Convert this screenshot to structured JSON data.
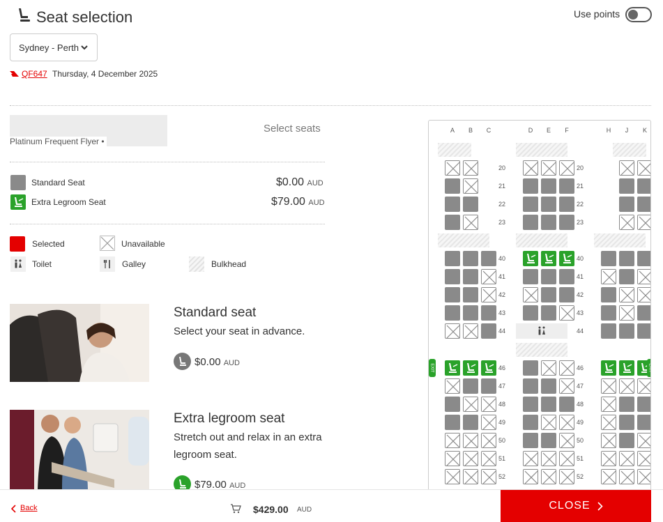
{
  "header": {
    "title": "Seat selection",
    "use_points_label": "Use points",
    "use_points_on": false
  },
  "route_select": {
    "value": "Sydney - Perth"
  },
  "flight": {
    "number": "QF647",
    "date": "Thursday, 4 December 2025"
  },
  "passenger": {
    "tier": "Platinum Frequent Flyer •",
    "select_seats_label": "Select seats"
  },
  "seat_types": [
    {
      "label": "Standard Seat",
      "price": "$0.00",
      "currency": "AUD"
    },
    {
      "label": "Extra Legroom Seat",
      "price": "$79.00",
      "currency": "AUD"
    }
  ],
  "legend": {
    "selected": "Selected",
    "unavailable": "Unavailable",
    "toilet": "Toilet",
    "galley": "Galley",
    "bulkhead": "Bulkhead"
  },
  "promos": [
    {
      "title": "Standard seat",
      "desc": "Select your seat in advance.",
      "price": "$0.00",
      "currency": "AUD"
    },
    {
      "title": "Extra legroom seat",
      "desc": "Stretch out and relax in an extra legroom seat.",
      "price": "$79.00",
      "currency": "AUD"
    }
  ],
  "seatmap": {
    "columns": [
      "A",
      "B",
      "C",
      "D",
      "E",
      "F",
      "H",
      "J",
      "K"
    ],
    "exit_label": "EXIT",
    "rows": [
      {
        "num": "20",
        "seats": "xx.xxx.xx"
      },
      {
        "num": "21",
        "seats": "ox.ooo.oo"
      },
      {
        "num": "22",
        "seats": "oo.ooo.oo"
      },
      {
        "num": "23",
        "seats": "ox.ooo.xx"
      },
      {
        "num": "40",
        "seats": "oooLLLooo"
      },
      {
        "num": "41",
        "seats": "ooxoooxox"
      },
      {
        "num": "42",
        "seats": "ooxxoooxx"
      },
      {
        "num": "43",
        "seats": "oooooxoxo"
      },
      {
        "num": "44",
        "seats": "xxo---ooo"
      },
      {
        "num": "46",
        "seats": "LLLoxxLLL"
      },
      {
        "num": "47",
        "seats": "xooooxxxx"
      },
      {
        "num": "48",
        "seats": "oxxoooxoo"
      },
      {
        "num": "49",
        "seats": "ooxoxxxoo"
      },
      {
        "num": "50",
        "seats": "xxxooxxox"
      },
      {
        "num": "51",
        "seats": "xxxxxxxxx"
      },
      {
        "num": "52",
        "seats": "xxxxxxxxx"
      }
    ]
  },
  "footer": {
    "back_label": "Back",
    "total": "$429.00",
    "currency": "AUD",
    "close_label": "CLOSE"
  },
  "colors": {
    "brand_red": "#e40000",
    "legroom_green": "#2aa22a",
    "seat_grey": "#8a8a8a"
  }
}
